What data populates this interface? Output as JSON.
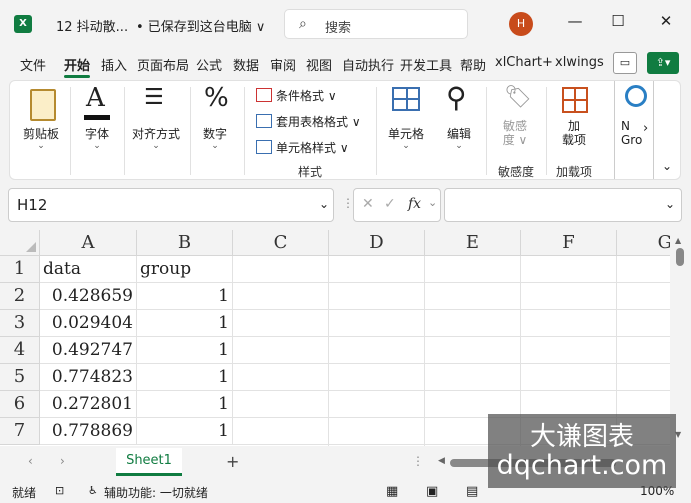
{
  "window": {
    "doc_title": "12 抖动散...",
    "save_status": "• 已保存到这台电脑 ∨",
    "search_placeholder": "搜索",
    "user_initial": "H"
  },
  "menu": [
    "文件",
    "开始",
    "插入",
    "页面布局",
    "公式",
    "数据",
    "审阅",
    "视图",
    "自动执行",
    "开发工具",
    "帮助",
    "xlChart+",
    "xlwings"
  ],
  "ribbon": {
    "clipboard": "剪贴板",
    "font": "字体",
    "alignment": "对齐方式",
    "number": "数字",
    "cond_format": "条件格式 ∨",
    "table_format": "套用表格格式 ∨",
    "cell_style": "单元格样式 ∨",
    "styles_group": "样式",
    "cells": "单元格",
    "editing": "编辑",
    "sensitivity": "敏感\n度 ∨",
    "sensitivity_group": "敏感度",
    "addins": "加\n载项",
    "addins_group": "加载项",
    "partial": "N\nGro",
    "more": "›"
  },
  "formula_bar": {
    "name_box": "H12",
    "cancel": "✕",
    "enter": "✓",
    "fx": "fx",
    "value": ""
  },
  "columns": [
    "A",
    "B",
    "C",
    "D",
    "E",
    "F",
    "G"
  ],
  "rows": [
    {
      "n": "1",
      "a": "data",
      "b": "group"
    },
    {
      "n": "2",
      "a": "0.428659",
      "b": "1"
    },
    {
      "n": "3",
      "a": "0.029404",
      "b": "1"
    },
    {
      "n": "4",
      "a": "0.492747",
      "b": "1"
    },
    {
      "n": "5",
      "a": "0.774823",
      "b": "1"
    },
    {
      "n": "6",
      "a": "0.272801",
      "b": "1"
    },
    {
      "n": "7",
      "a": "0.778869",
      "b": "1"
    }
  ],
  "sheet_tabs": {
    "active": "Sheet1",
    "add": "+"
  },
  "status": {
    "mode": "就绪",
    "accessibility": "辅助功能: 一切就绪",
    "zoom": "100%"
  },
  "watermark": {
    "line1": "大谦图表",
    "line2": "dqchart.com"
  },
  "colors": {
    "accent": "#107c41",
    "avatar": "#c84b1b"
  }
}
